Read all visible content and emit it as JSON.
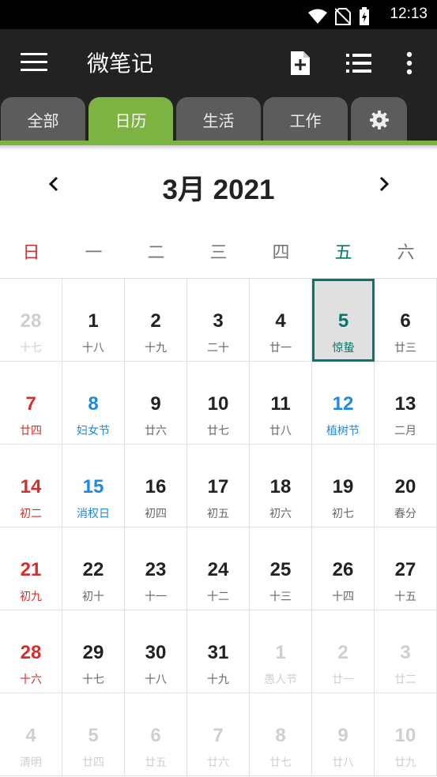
{
  "status_bar": {
    "time": "12:13",
    "icons": [
      "wifi-icon",
      "no-sim-icon",
      "battery-charging-icon"
    ]
  },
  "app_bar": {
    "title": "微笔记",
    "menu_icon": "hamburger-menu-icon",
    "actions": [
      "new-note-icon",
      "list-icon",
      "more-vert-icon"
    ]
  },
  "tabs": [
    {
      "label": "全部",
      "active": false
    },
    {
      "label": "日历",
      "active": true
    },
    {
      "label": "生活",
      "active": false
    },
    {
      "label": "工作",
      "active": false
    },
    {
      "label": "",
      "icon": "settings-gear-icon",
      "active": false
    }
  ],
  "calendar": {
    "month_title": "3月 2021",
    "weekdays": [
      "日",
      "一",
      "二",
      "三",
      "四",
      "五",
      "六"
    ],
    "weekday_colors": [
      "#d32f2f",
      "#777777",
      "#777777",
      "#777777",
      "#777777",
      "#00796b",
      "#777777"
    ],
    "today_color": "#00796b",
    "holiday_color": "#1e88e5",
    "weekend_color": "#d32f2f",
    "days": [
      [
        {
          "d": "28",
          "s": "十七",
          "t": "dim"
        },
        {
          "d": "1",
          "s": "十八"
        },
        {
          "d": "2",
          "s": "十九"
        },
        {
          "d": "3",
          "s": "二十"
        },
        {
          "d": "4",
          "s": "廿一"
        },
        {
          "d": "5",
          "s": "惊蛰",
          "t": "today"
        },
        {
          "d": "6",
          "s": "廿三"
        }
      ],
      [
        {
          "d": "7",
          "s": "廿四",
          "t": "red"
        },
        {
          "d": "8",
          "s": "妇女节",
          "t": "blue"
        },
        {
          "d": "9",
          "s": "廿六"
        },
        {
          "d": "10",
          "s": "廿七"
        },
        {
          "d": "11",
          "s": "廿八"
        },
        {
          "d": "12",
          "s": "植树节",
          "t": "blue"
        },
        {
          "d": "13",
          "s": "二月"
        }
      ],
      [
        {
          "d": "14",
          "s": "初二",
          "t": "red"
        },
        {
          "d": "15",
          "s": "消权日",
          "t": "blue"
        },
        {
          "d": "16",
          "s": "初四"
        },
        {
          "d": "17",
          "s": "初五"
        },
        {
          "d": "18",
          "s": "初六"
        },
        {
          "d": "19",
          "s": "初七"
        },
        {
          "d": "20",
          "s": "春分"
        }
      ],
      [
        {
          "d": "21",
          "s": "初九",
          "t": "red"
        },
        {
          "d": "22",
          "s": "初十"
        },
        {
          "d": "23",
          "s": "十一"
        },
        {
          "d": "24",
          "s": "十二"
        },
        {
          "d": "25",
          "s": "十三"
        },
        {
          "d": "26",
          "s": "十四"
        },
        {
          "d": "27",
          "s": "十五"
        }
      ],
      [
        {
          "d": "28",
          "s": "十六",
          "t": "red"
        },
        {
          "d": "29",
          "s": "十七"
        },
        {
          "d": "30",
          "s": "十八"
        },
        {
          "d": "31",
          "s": "十九"
        },
        {
          "d": "1",
          "s": "愚人节",
          "t": "dim"
        },
        {
          "d": "2",
          "s": "廿一",
          "t": "dim"
        },
        {
          "d": "3",
          "s": "廿二",
          "t": "dim"
        }
      ],
      [
        {
          "d": "4",
          "s": "清明",
          "t": "dim"
        },
        {
          "d": "5",
          "s": "廿四",
          "t": "dim"
        },
        {
          "d": "6",
          "s": "廿五",
          "t": "dim"
        },
        {
          "d": "7",
          "s": "廿六",
          "t": "dim"
        },
        {
          "d": "8",
          "s": "廿七",
          "t": "dim"
        },
        {
          "d": "9",
          "s": "廿八",
          "t": "dim"
        },
        {
          "d": "10",
          "s": "廿九",
          "t": "dim"
        }
      ]
    ]
  }
}
